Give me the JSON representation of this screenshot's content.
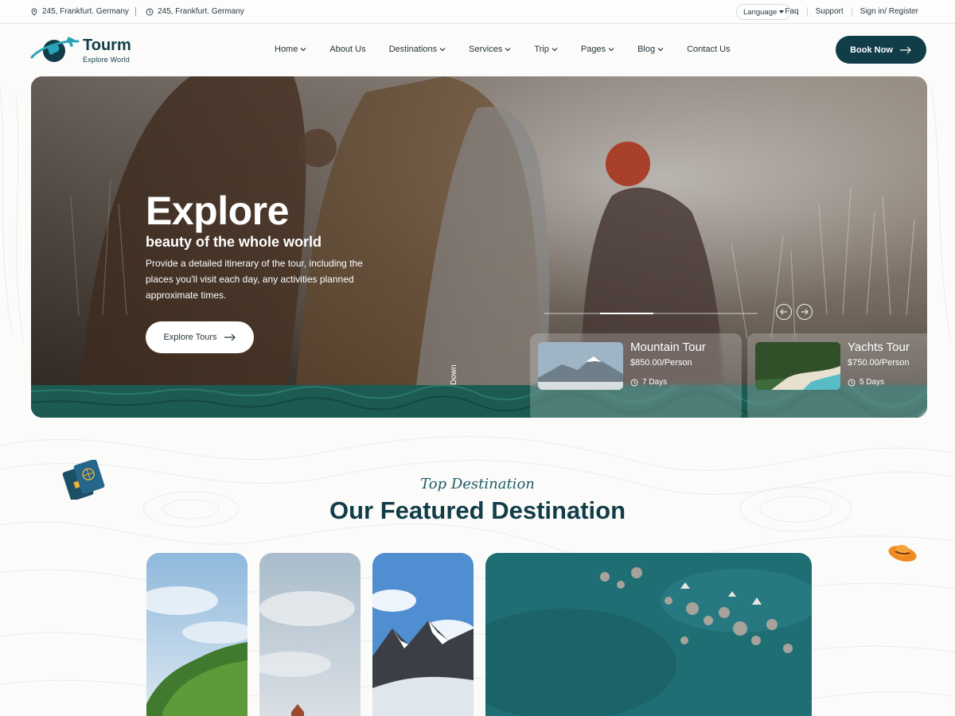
{
  "topbar": {
    "address_1": "245, Frankfurt. Germany",
    "address_2": "245, Frankfurt. Germany",
    "language": "Language",
    "links": [
      "Faq",
      "Support",
      "Sign in/ Register"
    ]
  },
  "header": {
    "logo_title": "Tourm",
    "logo_subtitle": "Explore World",
    "nav": [
      {
        "label": "Home",
        "dropdown": true
      },
      {
        "label": "About Us",
        "dropdown": false
      },
      {
        "label": "Destinations",
        "dropdown": true
      },
      {
        "label": "Services",
        "dropdown": true
      },
      {
        "label": "Trip",
        "dropdown": true
      },
      {
        "label": "Pages",
        "dropdown": true
      },
      {
        "label": "Blog",
        "dropdown": true
      },
      {
        "label": "Contact Us",
        "dropdown": false
      }
    ],
    "cta": "Book Now"
  },
  "hero": {
    "title": "Explore",
    "subtitle": "beauty of the whole world",
    "description": "Provide a detailed itinerary of the tour, including the places you'll visit each day, any activities planned approximate times.",
    "button": "Explore Tours",
    "scroll_label": "Down",
    "slider_progress": 0.25,
    "cards": [
      {
        "name": "Mountain Tour",
        "price": "$850.00/Person",
        "days": "7 Days"
      },
      {
        "name": "Yachts Tour",
        "price": "$750.00/Person",
        "days": "5 Days"
      }
    ]
  },
  "section": {
    "tag": "Top Destination",
    "title": "Our Featured Destination"
  },
  "colors": {
    "brand": "#113d48",
    "accent": "#1d5a6a"
  },
  "icons": [
    "location-icon",
    "clock-icon",
    "chevron-down-icon",
    "arrow-right-icon",
    "arrow-left-icon",
    "passport-icon",
    "hat-icon"
  ]
}
